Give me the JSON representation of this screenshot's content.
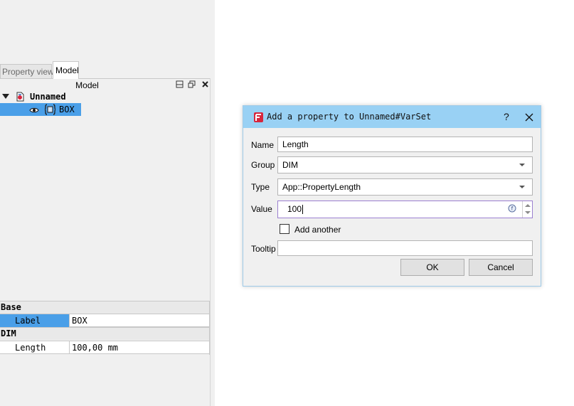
{
  "left_panel": {
    "tabs": [
      {
        "label": "Property view",
        "active": false
      },
      {
        "label": "Model",
        "active": true
      }
    ],
    "model_header": {
      "title": "Model"
    },
    "tree": {
      "document": {
        "label": "Unnamed",
        "expanded": true
      },
      "items": [
        {
          "label": "BOX",
          "selected": true,
          "visible": true
        }
      ]
    },
    "properties": {
      "groups": [
        {
          "name": "Base",
          "rows": [
            {
              "key": "Label",
              "value": "BOX",
              "selected": true
            }
          ]
        },
        {
          "name": "DIM",
          "rows": [
            {
              "key": "Length",
              "value": "100,00 mm",
              "selected": false
            }
          ]
        }
      ]
    }
  },
  "dialog": {
    "title": "Add a property to Unnamed#VarSet",
    "help_label": "?",
    "fields": {
      "name": {
        "label": "Name",
        "value": "Length"
      },
      "group": {
        "label": "Group",
        "value": "DIM"
      },
      "type": {
        "label": "Type",
        "value": "App::PropertyLength"
      },
      "value": {
        "label": "Value",
        "value": "100"
      },
      "add_another": {
        "label": "Add another",
        "checked": false
      },
      "tooltip": {
        "label": "Tooltip",
        "value": ""
      }
    },
    "buttons": {
      "ok": "OK",
      "cancel": "Cancel"
    }
  },
  "colors": {
    "title_bar": "#99d1f4",
    "selection": "#4a9fe8",
    "focus_border": "#9b7fd0",
    "freecad_red": "#d7263d"
  },
  "icons": [
    "expand-arrow-icon",
    "document-icon",
    "eye-icon",
    "varset-icon",
    "freecad-logo-icon",
    "close-icon",
    "expression-icon",
    "spin-up-icon",
    "spin-down-icon",
    "float-icon",
    "restore-icon"
  ]
}
